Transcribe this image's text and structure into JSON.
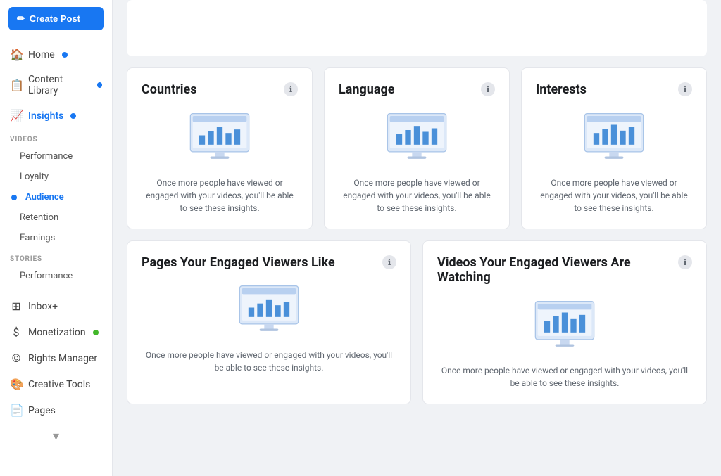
{
  "sidebar": {
    "create_button": "Create Post",
    "nav_items": [
      {
        "id": "home",
        "label": "Home",
        "icon": "🏠",
        "dot": true,
        "dot_color": "blue"
      },
      {
        "id": "content-library",
        "label": "Content Library",
        "icon": "📋",
        "dot": true,
        "dot_color": "blue"
      },
      {
        "id": "insights",
        "label": "Insights",
        "icon": "📈",
        "dot": true,
        "dot_color": "blue",
        "active": true
      }
    ],
    "videos_section": {
      "label": "VIDEOS",
      "sub_items": [
        {
          "id": "performance",
          "label": "Performance"
        },
        {
          "id": "loyalty",
          "label": "Loyalty"
        },
        {
          "id": "audience",
          "label": "Audience",
          "active": true
        }
      ]
    },
    "videos_extra": [
      {
        "id": "retention",
        "label": "Retention"
      },
      {
        "id": "earnings",
        "label": "Earnings"
      }
    ],
    "stories_section": {
      "label": "STORIES",
      "sub_items": [
        {
          "id": "stories-performance",
          "label": "Performance"
        }
      ]
    },
    "bottom_items": [
      {
        "id": "inbox",
        "label": "Inbox+",
        "icon": "⊞"
      },
      {
        "id": "monetization",
        "label": "Monetization",
        "icon": "💲",
        "dot": true,
        "dot_color": "green"
      },
      {
        "id": "rights-manager",
        "label": "Rights Manager",
        "icon": "©"
      },
      {
        "id": "creative-tools",
        "label": "Creative Tools",
        "icon": "🎨"
      },
      {
        "id": "pages",
        "label": "Pages",
        "icon": "📄"
      }
    ]
  },
  "top_cards": {
    "visible": true
  },
  "audience_cards_row1": [
    {
      "id": "countries",
      "title": "Countries",
      "message": "Once more people have viewed or engaged with your videos, you'll be able to see these insights."
    },
    {
      "id": "language",
      "title": "Language",
      "message": "Once more people have viewed or engaged with your videos, you'll be able to see these insights."
    },
    {
      "id": "interests",
      "title": "Interests",
      "message": "Once more people have viewed or engaged with your videos, you'll be able to see these insights."
    }
  ],
  "audience_cards_row2": [
    {
      "id": "pages-viewers",
      "title": "Pages Your Engaged Viewers Like",
      "message": "Once more people have viewed or engaged with your videos, you'll be able to see these insights."
    },
    {
      "id": "videos-watching",
      "title": "Videos Your Engaged Viewers Are Watching",
      "message": "Once more people have viewed or engaged with your videos, you'll be able to see these insights."
    }
  ],
  "info_icon_label": "ℹ"
}
